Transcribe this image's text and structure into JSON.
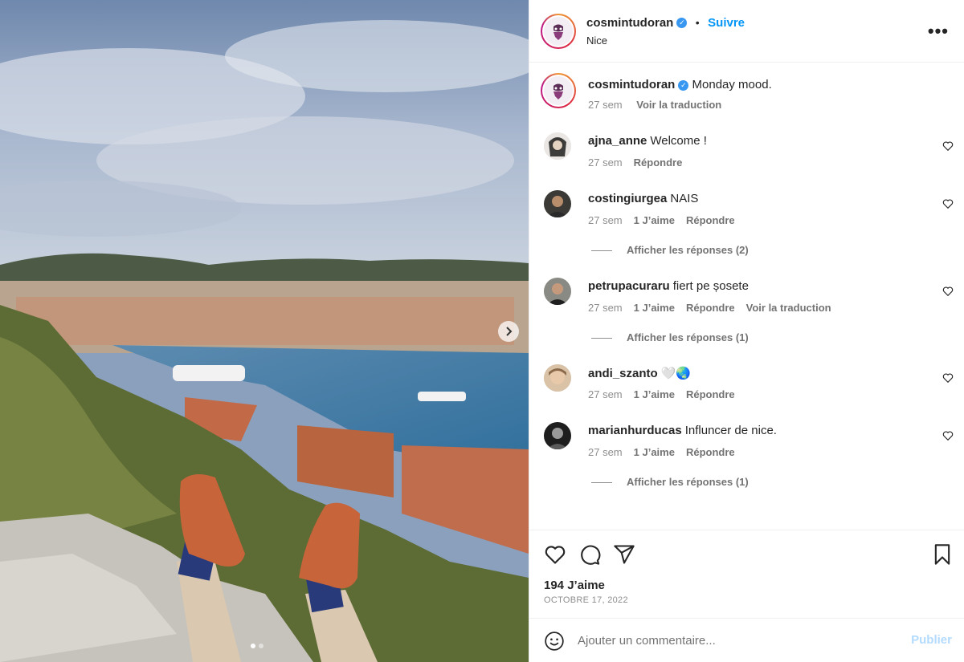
{
  "post": {
    "username": "cosmintudoran",
    "follow_label": "Suivre",
    "separator": "•",
    "location": "Nice",
    "more_label": "•••",
    "caption": "Monday mood.",
    "caption_time": "27 sem",
    "caption_translate": "Voir la traduction",
    "likes": "194 J’aime",
    "date": "OCTOBRE 17, 2022",
    "photo_count": 2,
    "current_photo": 1
  },
  "comments": [
    {
      "user": "ajna_anne",
      "text": "Welcome !",
      "time": "27 sem",
      "likes": "",
      "reply": "Répondre",
      "translate": "",
      "replies": ""
    },
    {
      "user": "costingiurgea",
      "text": "NAIS",
      "time": "27 sem",
      "likes": "1 J’aime",
      "reply": "Répondre",
      "translate": "",
      "replies": "Afficher les réponses (2)"
    },
    {
      "user": "petrupacuraru",
      "text": "fiert pe șosete",
      "time": "27 sem",
      "likes": "1 J’aime",
      "reply": "Répondre",
      "translate": "Voir la traduction",
      "replies": "Afficher les réponses (1)"
    },
    {
      "user": "andi_szanto",
      "text": "🤍🌏",
      "time": "27 sem",
      "likes": "1 J’aime",
      "reply": "Répondre",
      "translate": "",
      "replies": ""
    },
    {
      "user": "marianhurducas",
      "text": "Influncer de nice.",
      "time": "27 sem",
      "likes": "1 J’aime",
      "reply": "Répondre",
      "translate": "",
      "replies": "Afficher les réponses (1)"
    }
  ],
  "composer": {
    "placeholder": "Ajouter un commentaire...",
    "publish_label": "Publier"
  },
  "icons": {
    "like": "heart-icon",
    "comment": "comment-icon",
    "share": "share-icon",
    "save": "bookmark-icon",
    "emoji": "emoji-icon",
    "next": "chevron-right-icon"
  },
  "colors": {
    "accent": "#0095f6",
    "verified": "#3897f0",
    "muted": "#8e8e8e",
    "publish_disabled": "#b3dbff"
  }
}
